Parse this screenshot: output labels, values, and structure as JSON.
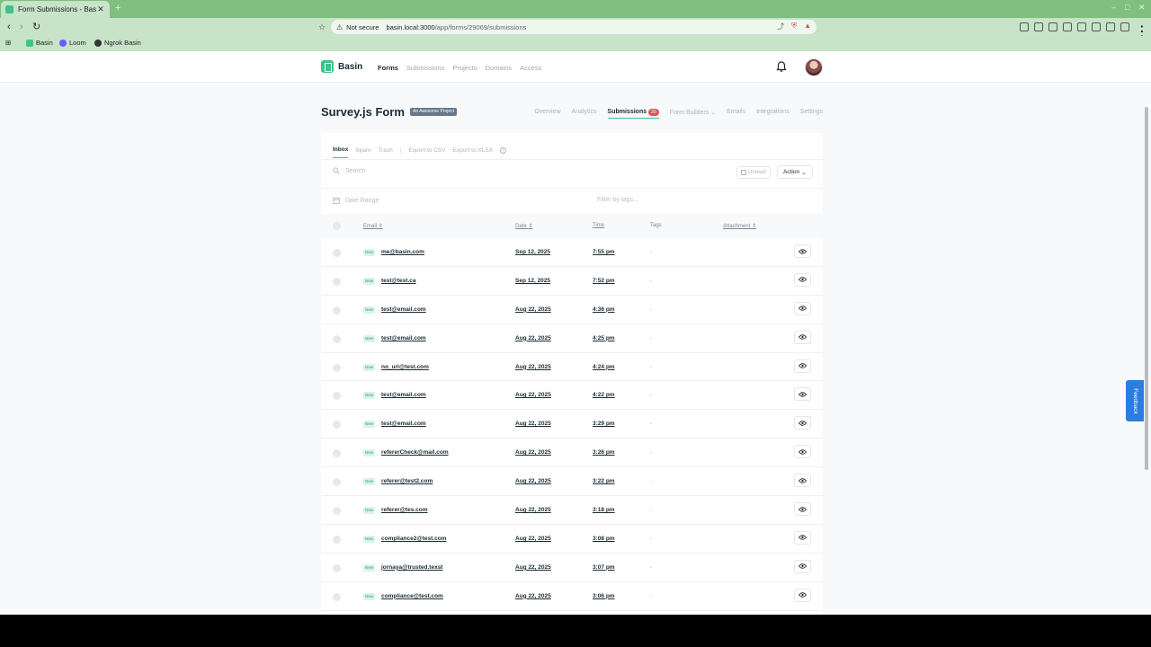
{
  "browser": {
    "tab_title": "Form Submissions - Basin",
    "new_tab": "+",
    "security": "Not secure",
    "url_host": "basin.local:3000",
    "url_path": "/app/forms/29069/submissions",
    "bookmarks": [
      "Basin",
      "Loom",
      "Ngrok Basin"
    ]
  },
  "app": {
    "brand": "Basin",
    "nav": [
      "Forms",
      "Submissions",
      "Projects",
      "Domains",
      "Access"
    ]
  },
  "form": {
    "title": "Survey.js Form",
    "project_badge": "An Awesome Project",
    "subnav": {
      "overview": "Overview",
      "analytics": "Analytics",
      "submissions": "Submissions",
      "submissions_count": "20",
      "form_builders": "Form Builders",
      "emails": "Emails",
      "integrations": "Integrations",
      "settings": "Settings"
    }
  },
  "toolbar": {
    "tabs": {
      "inbox": "Inbox",
      "spam": "Spam",
      "trash": "Trash",
      "separator": "|",
      "export_csv": "Export to CSV",
      "export_xlsx": "Export to XLSX"
    },
    "search_placeholder": "Search",
    "unread_label": "Unread",
    "action_label": "Action",
    "date_range_placeholder": "Date Range",
    "tags_filter_placeholder": "Filter by tags..."
  },
  "table": {
    "headers": {
      "email": "Email",
      "date": "Date",
      "time": "Time",
      "tags": "Tags",
      "attachment": "Attachment"
    },
    "new_label": "New",
    "empty_tags": "-",
    "rows": [
      {
        "email": "me@basin.com",
        "date": "Sep 12, 2025",
        "time": "7:55 pm"
      },
      {
        "email": "test@test.ca",
        "date": "Sep 12, 2025",
        "time": "7:52 pm"
      },
      {
        "email": "test@email.com",
        "date": "Aug 22, 2025",
        "time": "4:36 pm"
      },
      {
        "email": "test@email.com",
        "date": "Aug 22, 2025",
        "time": "4:25 pm"
      },
      {
        "email": "no_url@test.com",
        "date": "Aug 22, 2025",
        "time": "4:24 pm"
      },
      {
        "email": "test@email.com",
        "date": "Aug 22, 2025",
        "time": "4:22 pm"
      },
      {
        "email": "test@email.com",
        "date": "Aug 22, 2025",
        "time": "3:29 pm"
      },
      {
        "email": "refererCheck@mail.com",
        "date": "Aug 22, 2025",
        "time": "3:26 pm"
      },
      {
        "email": "referer@test2.com",
        "date": "Aug 22, 2025",
        "time": "3:22 pm"
      },
      {
        "email": "referer@tes.com",
        "date": "Aug 22, 2025",
        "time": "3:18 pm"
      },
      {
        "email": "compliance2@test.com",
        "date": "Aug 22, 2025",
        "time": "3:08 pm"
      },
      {
        "email": "jornaya@trusted.texst",
        "date": "Aug 22, 2025",
        "time": "3:07 pm"
      },
      {
        "email": "compliance@test.com",
        "date": "Aug 22, 2025",
        "time": "3:06 pm"
      }
    ]
  },
  "feedback_label": "Feedback",
  "colors": {
    "brand_green": "#3ec38a",
    "browser_green": "#7fbf80",
    "badge_red": "#e2525b",
    "feedback_blue": "#2a7de1"
  }
}
